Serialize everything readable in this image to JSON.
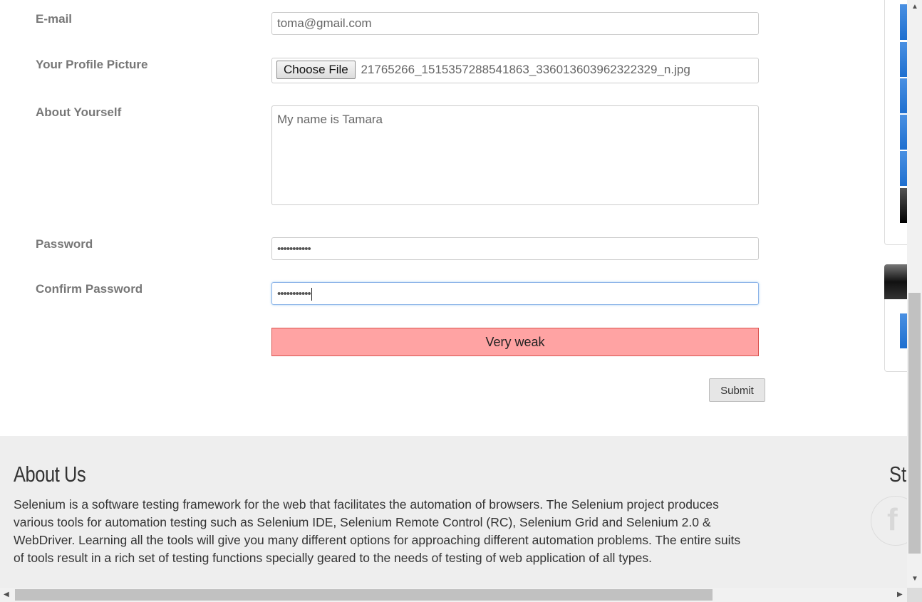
{
  "form": {
    "email": {
      "label": "E-mail",
      "value": "toma@gmail.com"
    },
    "picture": {
      "label": "Your Profile Picture",
      "button_label": "Choose File",
      "file_name": "21765266_1515357288541863_336013603962322329_n.jpg"
    },
    "about": {
      "label": "About Yourself",
      "value": "My name is Tamara"
    },
    "password": {
      "label": "Password",
      "value": "•••••••••••"
    },
    "confirm_password": {
      "label": "Confirm Password",
      "value": "•••••••••••"
    },
    "strength": {
      "text": "Very weak",
      "color": "#ffa3a3"
    },
    "submit_label": "Submit"
  },
  "footer": {
    "about_title": "About Us",
    "about_text": "Selenium is a software testing framework for the web that facilitates the automation of browsers. The Selenium project produces various tools for automation testing such as Selenium IDE, Selenium Remote Control (RC), Selenium Grid and Selenium 2.0 & WebDriver. Learning all the tools will give you many different options for approaching different automation problems. The entire suits of tools result in a rich set of testing functions specially geared to the needs of testing of web application of all types.",
    "social_title_partial": "St",
    "social_icon": "facebook-icon",
    "social_icon_glyph": "f"
  },
  "scrollbars": {
    "up_arrow": "▲",
    "down_arrow": "▼",
    "left_arrow": "◀",
    "right_arrow": "▶"
  }
}
